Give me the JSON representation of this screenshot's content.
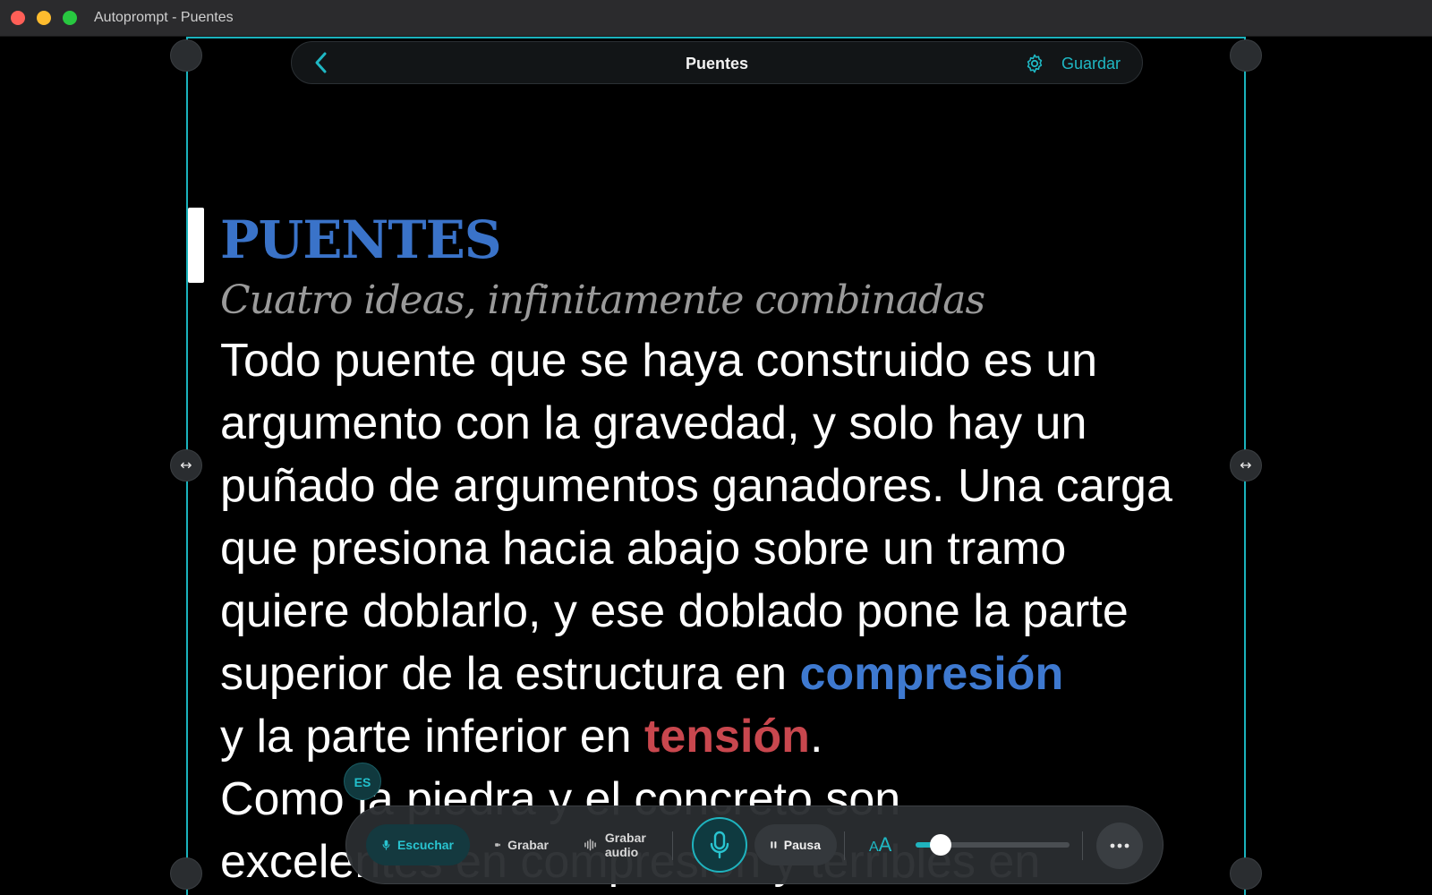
{
  "window": {
    "title": "Autoprompt - Puentes"
  },
  "topbar": {
    "back_icon": "chevron-left-icon",
    "title": "Puentes",
    "settings_icon": "gear-icon",
    "save_label": "Guardar"
  },
  "script": {
    "heading": "PUENTES",
    "subtitle": "Cuatro ideas, infinitamente combinadas",
    "lines": [
      "Todo puente que se haya construido es un",
      "argumento con la gravedad, y solo hay un",
      "puñado de argumentos ganadores. Una carga",
      "que presiona hacia abajo sobre un tramo",
      "quiere doblarlo, y ese doblado pone la parte"
    ],
    "line6_pre": "superior de la estructura en ",
    "line6_kw": "compresión",
    "line7_pre": "y la parte inferior en ",
    "line7_kw": "tensión",
    "line7_post": ".",
    "line8": "Como la piedra y el concreto son",
    "line9": "excelentes en compresión y terribles en"
  },
  "language_badge": "ES",
  "controls": {
    "listen_label": "Escuchar",
    "record_label": "Grabar",
    "record_audio_label": "Grabar audio",
    "pause_label": "Pausa",
    "font_size_label_a": "A",
    "font_size_label_b": "A",
    "font_size_level": 0.16
  },
  "colors": {
    "accent": "#1fb3be",
    "keyword_blue": "#3e79d0",
    "keyword_red": "#c9474e"
  }
}
